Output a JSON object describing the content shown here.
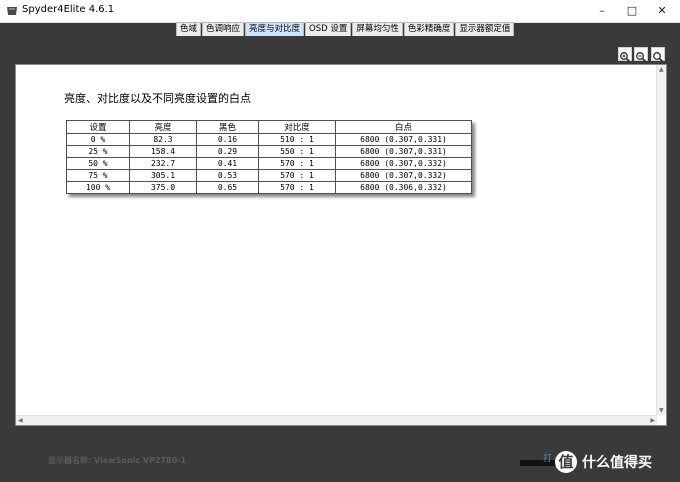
{
  "window": {
    "title": "Spyder4Elite 4.6.1"
  },
  "tabs": [
    "色域",
    "色调响应",
    "亮度与对比度",
    "OSD 设置",
    "屏幕均匀性",
    "色彩精确度",
    "显示器额定值"
  ],
  "active_tab_index": 2,
  "zoom_icons": [
    "zoom-in-icon",
    "zoom-out-icon",
    "zoom-fit-icon"
  ],
  "report": {
    "heading": "亮度、对比度以及不同亮度设置的白点",
    "columns": [
      "设置",
      "亮度",
      "黑色",
      "对比度",
      "白点"
    ],
    "rows": [
      [
        "0 %",
        "82.3",
        "0.16",
        "510 : 1",
        "6800 (0.307,0.331)"
      ],
      [
        "25 %",
        "158.4",
        "0.29",
        "550 : 1",
        "6800 (0.307,0.331)"
      ],
      [
        "50 %",
        "232.7",
        "0.41",
        "570 : 1",
        "6800 (0.307,0.332)"
      ],
      [
        "75 %",
        "305.1",
        "0.53",
        "570 : 1",
        "6800 (0.307,0.332)"
      ],
      [
        "100 %",
        "375.0",
        "0.65",
        "570 : 1",
        "6800 (0.306,0.332)"
      ]
    ]
  },
  "footer": {
    "display_name": "显示器名称: ViewSonic VP2780-1",
    "button_fragment": "打",
    "watermark_icon": "值",
    "watermark_text": "什么值得买"
  }
}
